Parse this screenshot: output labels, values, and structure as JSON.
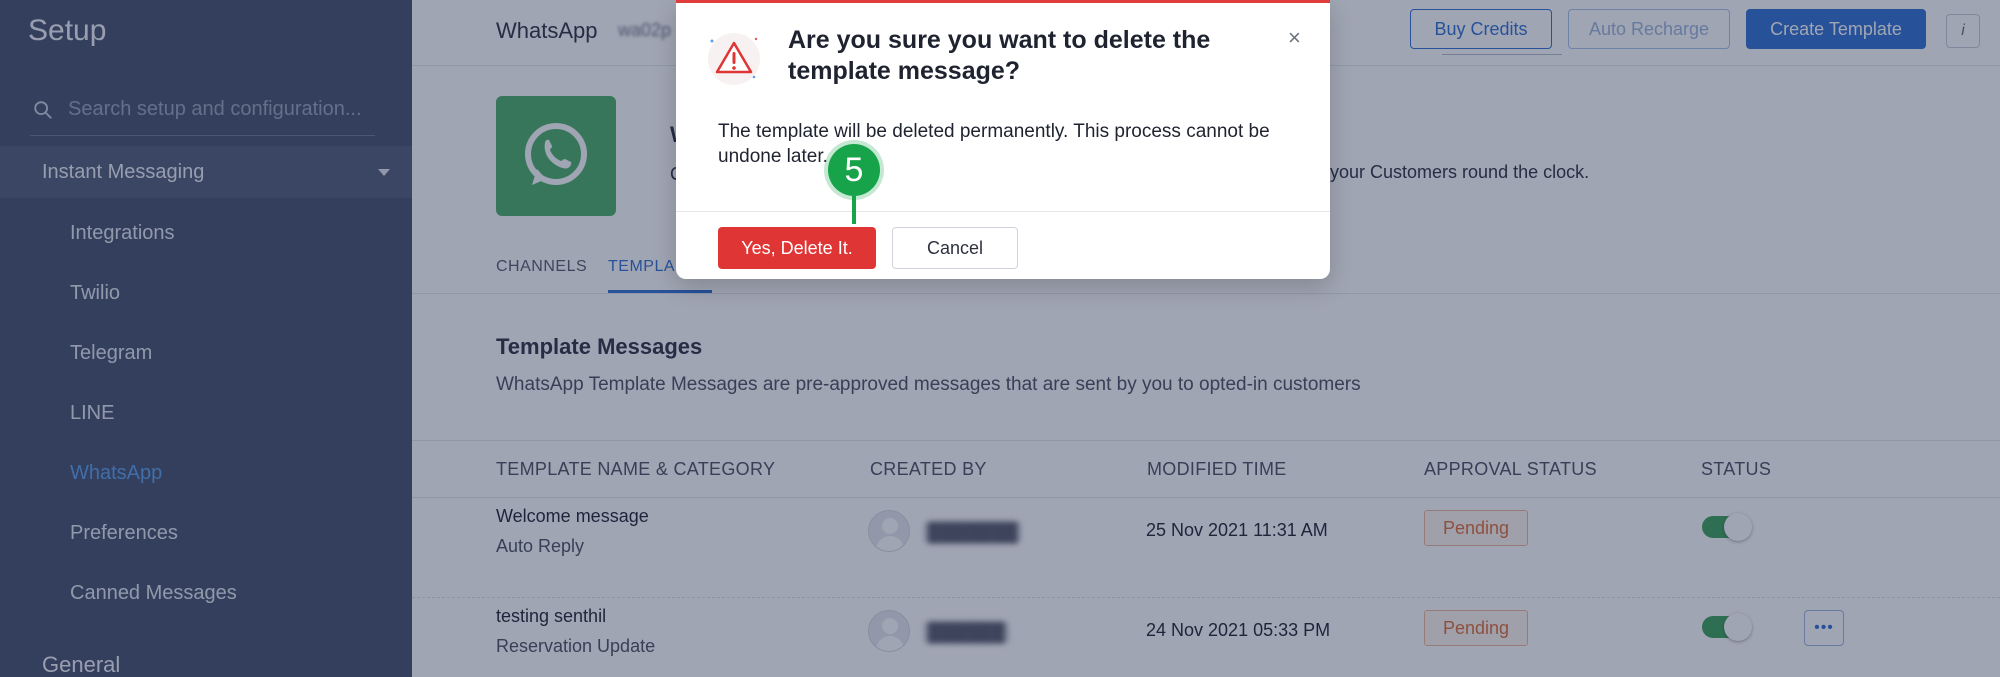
{
  "sidebar": {
    "title": "Setup",
    "search_placeholder": "Search setup and configuration...",
    "group_label": "Instant Messaging",
    "items": [
      {
        "label": "Integrations"
      },
      {
        "label": "Twilio"
      },
      {
        "label": "Telegram"
      },
      {
        "label": "LINE"
      },
      {
        "label": "WhatsApp"
      },
      {
        "label": "Preferences"
      },
      {
        "label": "Canned Messages"
      }
    ],
    "next_group_label": "General",
    "active_item": "WhatsApp",
    "active_color": "#5aa1f0"
  },
  "topbar": {
    "app_name": "WhatsApp",
    "app_id_partial": "wa02p",
    "buttons": {
      "buy_credits": "Buy Credits",
      "auto_recharge": "Auto Recharge",
      "create_template": "Create Template"
    },
    "info_label": "i"
  },
  "header": {
    "title_fragment": "W",
    "desc_fragment": "C",
    "desc_tail": "your Customers round the clock."
  },
  "tabs": [
    {
      "label": "CHANNELS"
    },
    {
      "label": "TEMPLA"
    }
  ],
  "templates": {
    "section_title": "Template Messages",
    "section_desc": "WhatsApp Template Messages are pre-approved messages that are sent by you to opted-in customers",
    "columns": [
      "TEMPLATE NAME & CATEGORY",
      "CREATED BY",
      "MODIFIED TIME",
      "APPROVAL STATUS",
      "STATUS"
    ],
    "rows": [
      {
        "name": "Welcome message",
        "category": "Auto Reply",
        "created_by": "███████",
        "modified_time": "25 Nov 2021 11:31 AM",
        "approval_status": "Pending",
        "status_on": true
      },
      {
        "name": "testing senthil",
        "category": "Reservation Update",
        "created_by": "██████",
        "modified_time": "24 Nov 2021 05:33 PM",
        "approval_status": "Pending",
        "status_on": true,
        "more_label": "•••"
      }
    ]
  },
  "modal": {
    "title": "Are you sure you want to delete the template message?",
    "body": "The template will be deleted permanently. This process cannot be undone later.",
    "confirm_label": "Yes, Delete It.",
    "cancel_label": "Cancel",
    "close_label": "×",
    "icon": "warning-triangle-icon",
    "accent_color": "#e03535"
  },
  "annotation": {
    "step_number": "5",
    "color": "#16a34a"
  },
  "colors": {
    "sidebar_bg": "#45506b",
    "primary": "#2f6fd3",
    "pending": "#e06d35",
    "toggle_on": "#3ca25a",
    "whatsapp_green": "#4caf6a"
  }
}
